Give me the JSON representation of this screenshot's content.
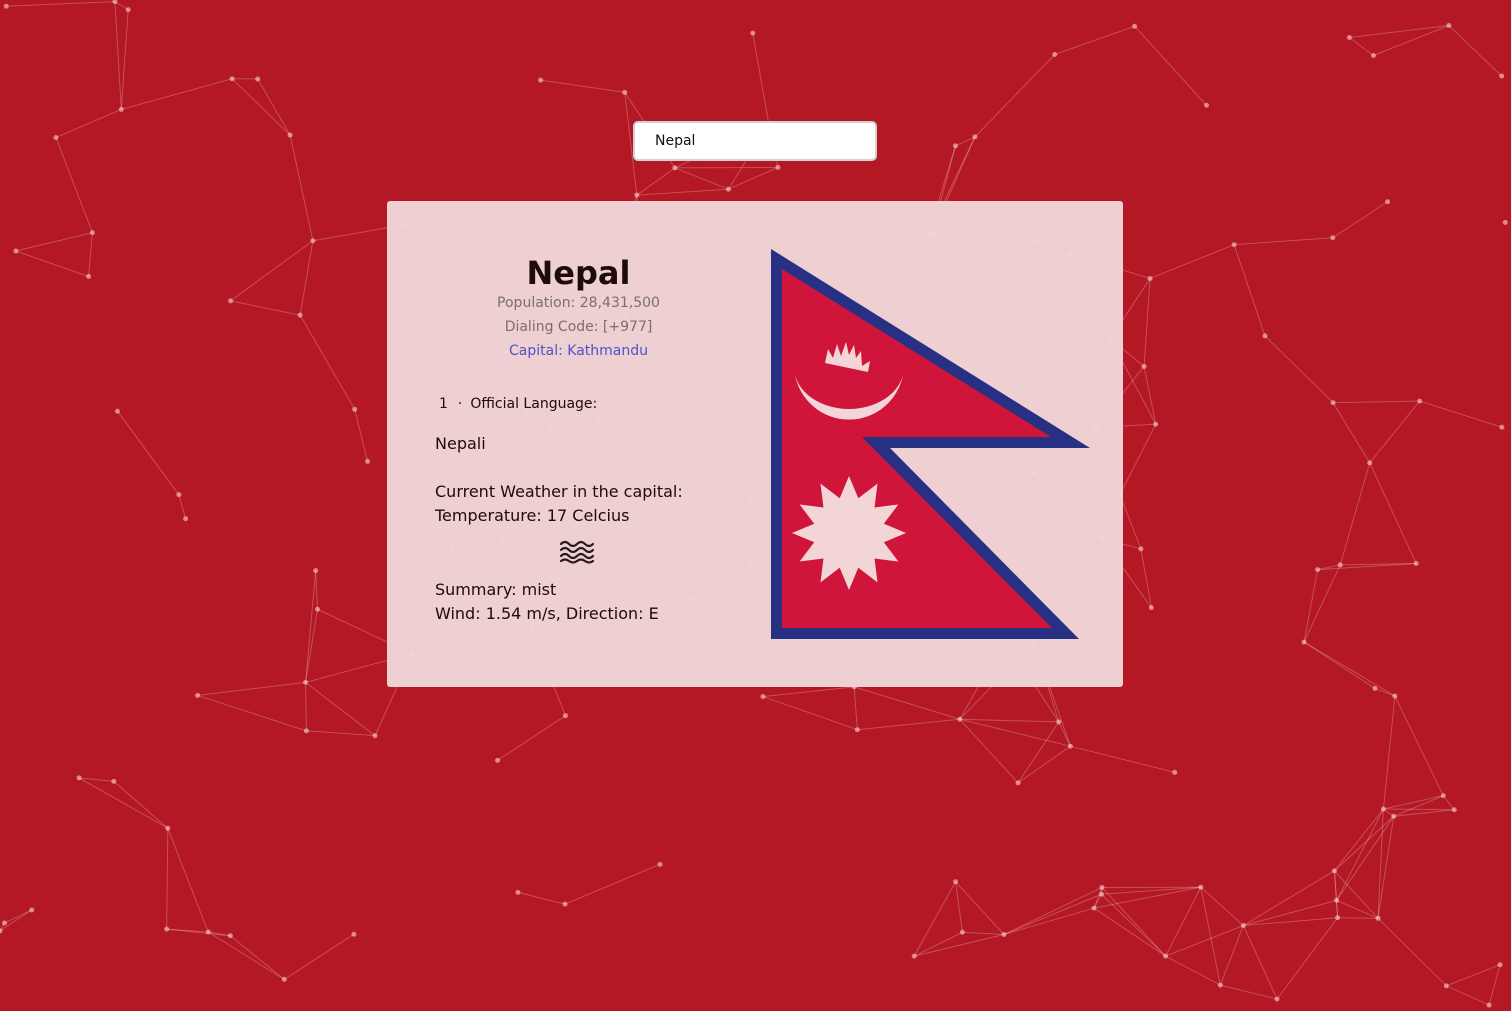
{
  "search": {
    "value": "Nepal"
  },
  "country": {
    "name": "Nepal",
    "population": "Population: 28,431,500",
    "dialing_code": "Dialing Code: [+977]",
    "capital": "Capital: Kathmandu"
  },
  "languages": {
    "count": "1",
    "separator": "·",
    "label": "Official Language:",
    "items": [
      "Nepali"
    ]
  },
  "weather": {
    "heading": "Current Weather in the capital:",
    "temperature": "Temperature: 17 Celcius",
    "icon": "mist-icon",
    "summary": "Summary: mist",
    "wind": "Wind: 1.54 m/s, Direction: E"
  },
  "flag": {
    "country": "Nepal",
    "colors": {
      "crimson": "#d0153a",
      "border": "#283083",
      "emblem": "#f3d5d8"
    }
  },
  "colors": {
    "background": "#b31824",
    "card": "#f0d6d8",
    "link": "#4f52c9",
    "muted_text": "#7a6f70",
    "text": "#1e0b0c"
  }
}
